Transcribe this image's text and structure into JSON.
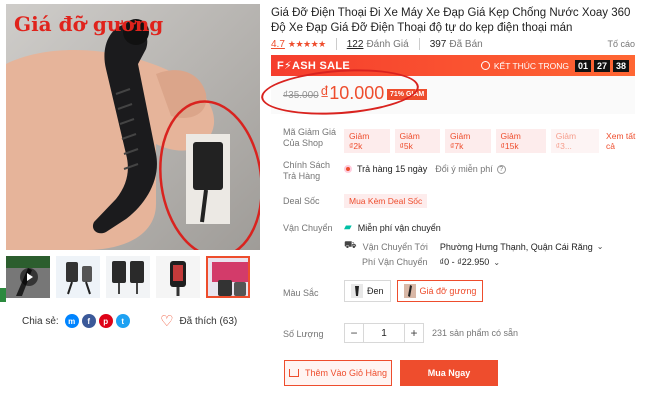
{
  "product": {
    "image_caption": "Giá đỡ gương",
    "title": "Giá Đỡ Điện Thoại Đi Xe Máy Xe Đạp Giá Kẹp Chống Nước Xoay 360 Độ Xe Đạp Giá Đỡ Điện Thoại độ tự do kẹp điện thoại mán",
    "rating_score": "4.7",
    "rating_stars": "★★★★★",
    "ratings_count": "122",
    "ratings_label": "Đánh Giá",
    "sold_count": "397",
    "sold_label": "Đã Bán",
    "report_label": "Tố cáo"
  },
  "flash_sale": {
    "title": "F⚡ASH SALE",
    "ends_label": "KẾT THÚC TRONG",
    "hours": "01",
    "minutes": "27",
    "seconds": "38"
  },
  "price": {
    "original": "₫35.000",
    "current": "₫10.000",
    "discount": "71% GIẢM"
  },
  "vouchers": {
    "label": "Mã Giảm Giá Của Shop",
    "items": [
      "Giảm ₫2k",
      "Giảm ₫5k",
      "Giảm ₫7k",
      "Giảm ₫15k",
      "Giảm ₫3..."
    ],
    "see_all": "Xem tất cả"
  },
  "return_policy": {
    "label": "Chính Sách Trả Hàng",
    "text": "Trả hàng 15 ngày",
    "note": "Đổi ý miễn phí"
  },
  "deal": {
    "label": "Deal Sốc",
    "tag": "Mua Kèm Deal Sốc"
  },
  "shipping": {
    "label": "Vận Chuyển",
    "free": "Miễn phí vận chuyển",
    "to_label": "Vận Chuyển Tới",
    "to_value": "Phường Hưng Thạnh, Quận Cái Răng",
    "fee_label": "Phí Vận Chuyển",
    "fee_value": "₫0 - ₫22.950"
  },
  "variants": {
    "label": "Màu Sắc",
    "options": [
      "Đen",
      "Giá đỡ gương"
    ],
    "selected": "Giá đỡ gương"
  },
  "quantity": {
    "label": "Số Lượng",
    "value": "1",
    "minus": "−",
    "plus": "+",
    "stock": "231 sản phẩm có sẵn"
  },
  "actions": {
    "add_to_cart": "Thêm Vào Giỏ Hàng",
    "buy_now": "Mua Ngay"
  },
  "social": {
    "share_label": "Chia sẻ:",
    "liked_label": "Đã thích (63)"
  },
  "colors": {
    "brand": "#ee4d2d",
    "annotation_red": "#d9231f"
  }
}
